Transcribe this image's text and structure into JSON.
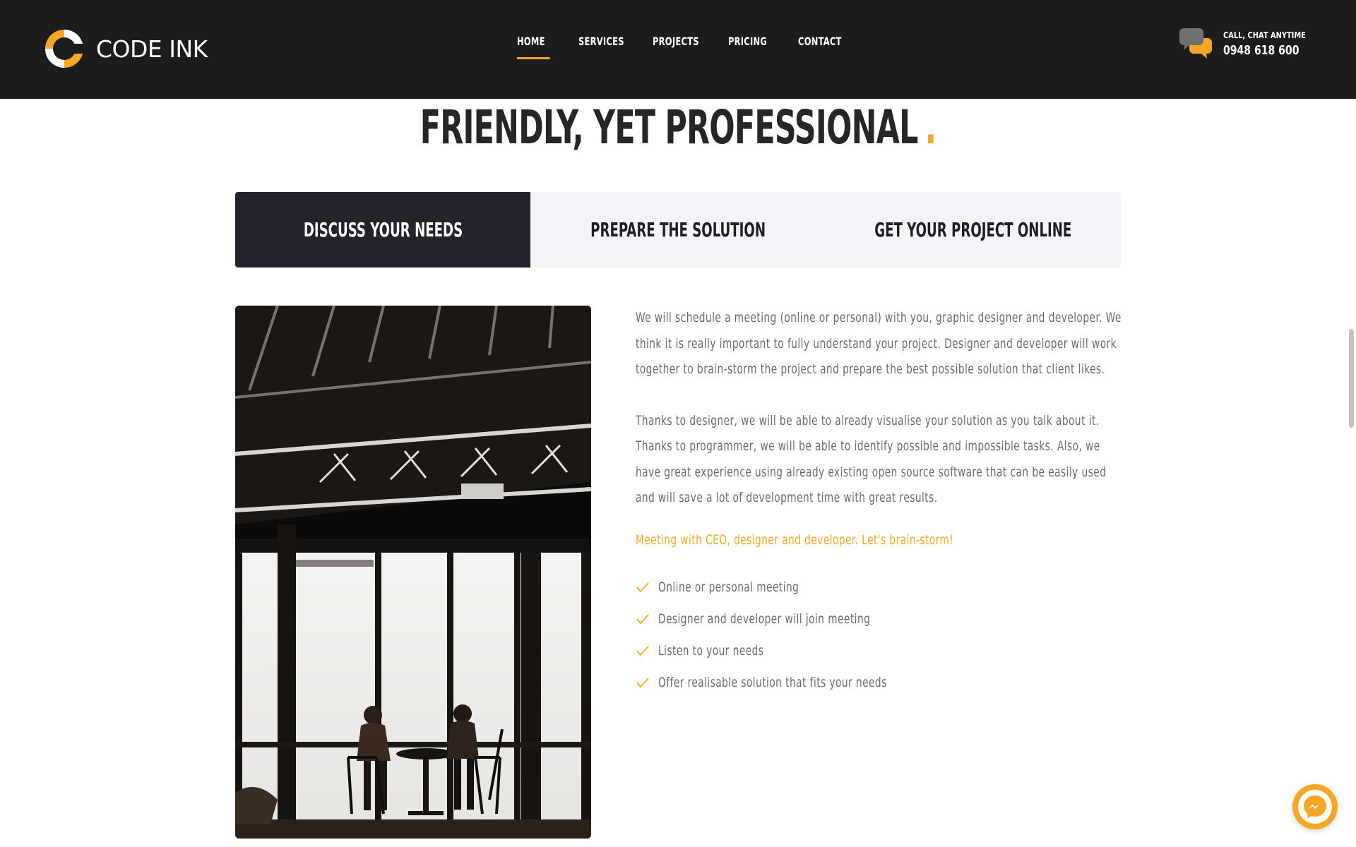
{
  "brand": {
    "name": "CODE INK",
    "accent": "#f5a623",
    "dark": "#1c1c1c"
  },
  "nav": {
    "items": [
      {
        "label": "HOME",
        "active": true
      },
      {
        "label": "SERVICES",
        "active": false
      },
      {
        "label": "PROJECTS",
        "active": false
      },
      {
        "label": "PRICING",
        "active": false
      },
      {
        "label": "CONTACT",
        "active": false
      }
    ]
  },
  "contact": {
    "caption": "CALL, CHAT ANYTIME",
    "phone": "0948 618 600",
    "icon": "chat-bubbles-icon"
  },
  "section": {
    "title": "FRIENDLY, YET PROFESSIONAL",
    "title_dot": "."
  },
  "tabs": [
    {
      "label": "DISCUSS YOUR NEEDS",
      "active": true
    },
    {
      "label": "PREPARE THE SOLUTION",
      "active": false
    },
    {
      "label": "GET YOUR PROJECT ONLINE",
      "active": false
    }
  ],
  "content": {
    "paragraphs": [
      "We will schedule a meeting (online or personal) with you, graphic designer and developer. We think it is really important to fully understand your project. Designer and developer will work together to brain-storm the project and prepare the best possible solution that client likes.",
      "Thanks to designer, we will be able to already visualise your solution as you talk about it. Thanks to programmer, we will be able to identify possible and impossible tasks. Also, we have great experience using already existing open source software that can be easily used and will save a lot of development time with great results."
    ],
    "highlight": "Meeting with CEO, designer and developer. Let's brain-storm!",
    "checklist": [
      "Online or personal meeting",
      "Designer and developer will join meeting",
      "Listen to your needs",
      "Offer realisable solution that fits your needs"
    ]
  },
  "widgets": {
    "messenger_icon": "messenger-icon"
  }
}
